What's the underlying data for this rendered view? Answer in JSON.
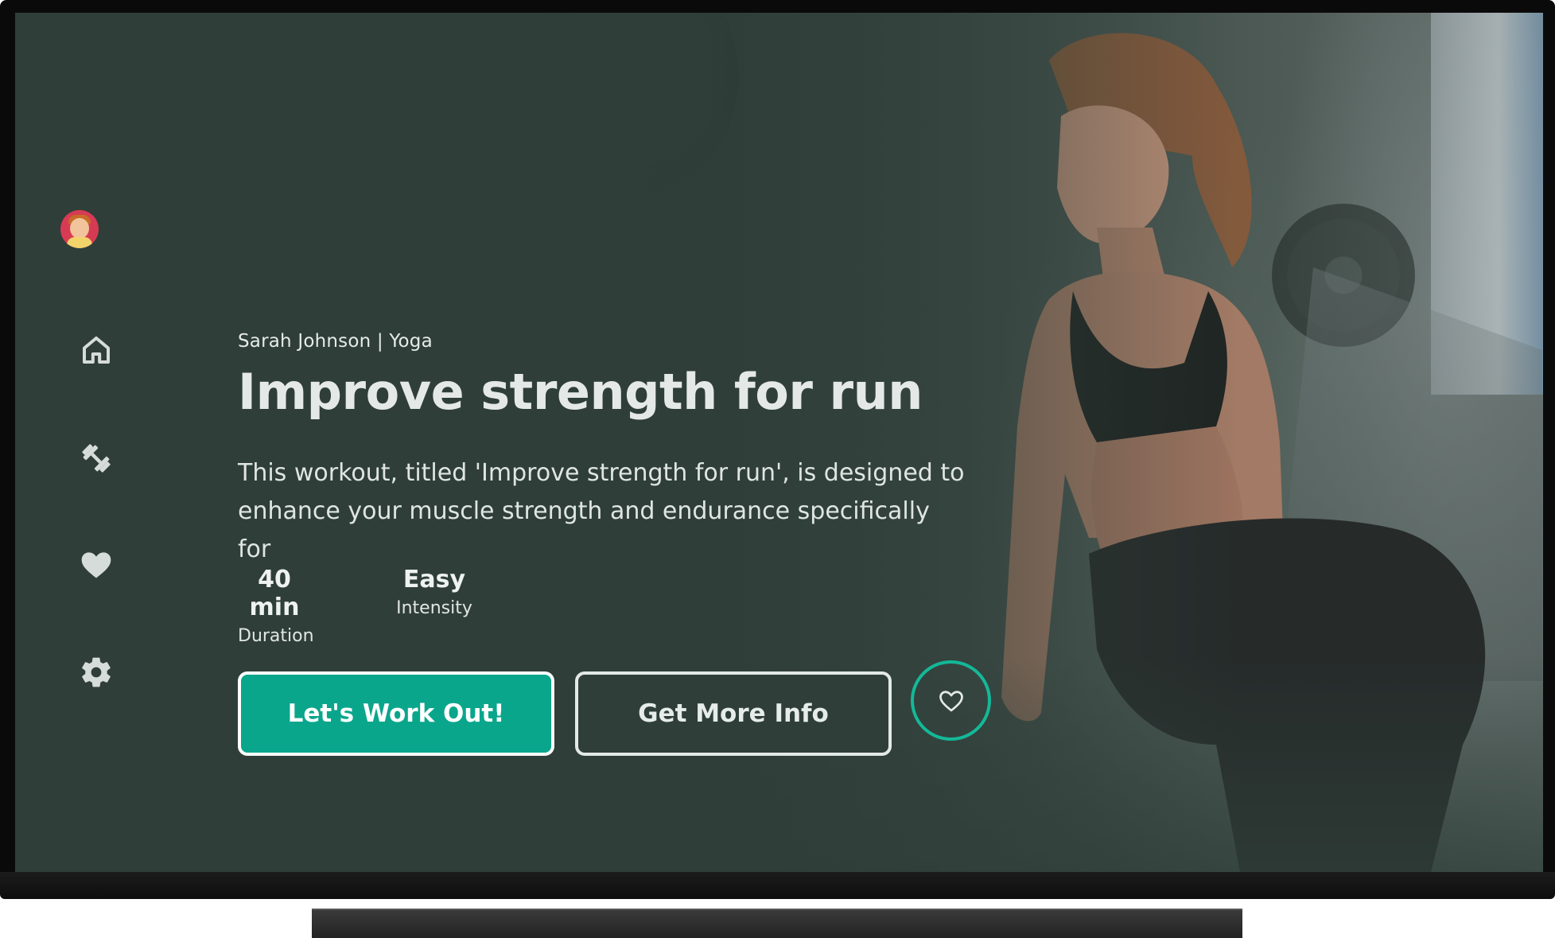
{
  "workout": {
    "meta": "Sarah Johnson | Yoga",
    "title": "Improve strength for run",
    "description": "This workout, titled 'Improve strength for run', is designed to enhance your muscle strength and endurance specifically for",
    "stats": [
      {
        "value": "40 min",
        "label": "Duration"
      },
      {
        "value": "Easy",
        "label": "Intensity"
      }
    ]
  },
  "actions": {
    "primary_label": "Let's Work Out!",
    "secondary_label": "Get More Info",
    "favorite_icon": "heart-outline-icon"
  },
  "sidebar": {
    "items": [
      {
        "icon": "user-avatar"
      },
      {
        "icon": "home-icon"
      },
      {
        "icon": "dumbbell-icon"
      },
      {
        "icon": "heart-icon"
      },
      {
        "icon": "gear-icon"
      }
    ]
  },
  "colors": {
    "background": "#2f3e39",
    "accent": "#0aa68c",
    "accent_ring": "#14b898",
    "text": "#e4e9e7"
  }
}
